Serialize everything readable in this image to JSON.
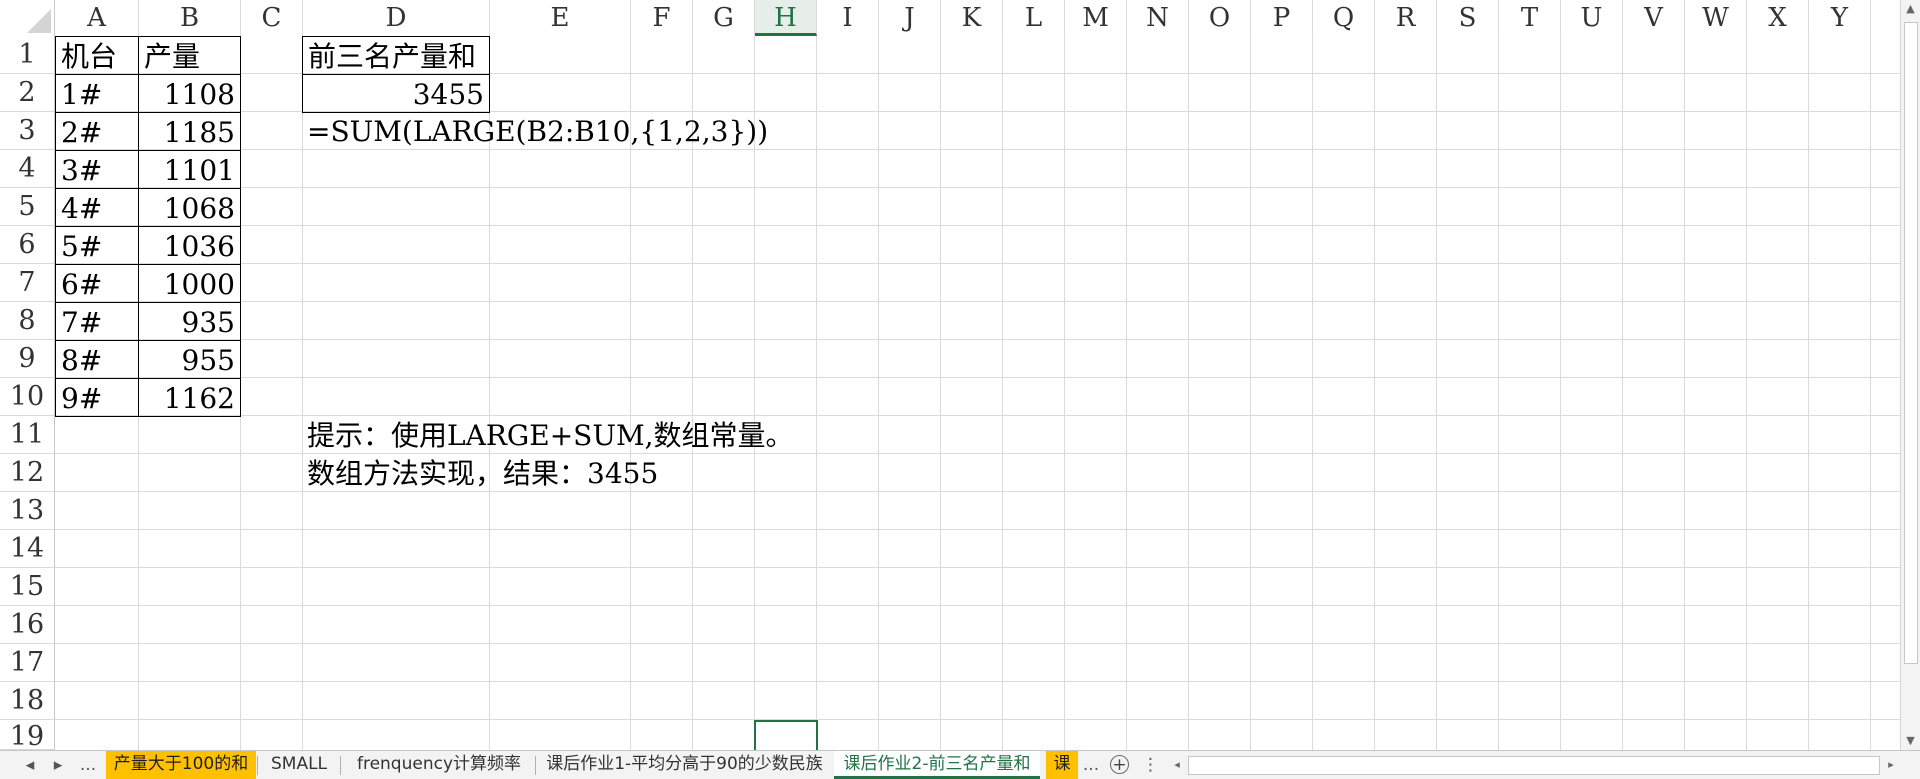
{
  "columns": [
    "A",
    "B",
    "C",
    "D",
    "E",
    "F",
    "G",
    "H",
    "I",
    "J",
    "K",
    "L",
    "M",
    "N",
    "O",
    "P",
    "Q",
    "R",
    "S",
    "T",
    "U",
    "V",
    "W",
    "X",
    "Y"
  ],
  "selected_column": "H",
  "rows": [
    "1",
    "2",
    "3",
    "4",
    "5",
    "6",
    "7",
    "8",
    "9",
    "10",
    "11",
    "12",
    "13",
    "14",
    "15",
    "16",
    "17",
    "18",
    "19"
  ],
  "table": {
    "header_machine": "机台",
    "header_output": "产量",
    "entries": [
      {
        "machine": "1#",
        "output": "1108"
      },
      {
        "machine": "2#",
        "output": "1185"
      },
      {
        "machine": "3#",
        "output": "1101"
      },
      {
        "machine": "4#",
        "output": "1068"
      },
      {
        "machine": "5#",
        "output": "1036"
      },
      {
        "machine": "6#",
        "output": "1000"
      },
      {
        "machine": "7#",
        "output": "935"
      },
      {
        "machine": "8#",
        "output": "955"
      },
      {
        "machine": "9#",
        "output": "1162"
      }
    ]
  },
  "result_block": {
    "title": "前三名产量和",
    "value": "3455",
    "formula": "=SUM(LARGE(B2:B10,{1,2,3}))"
  },
  "notes": {
    "line1": "提示：使用LARGE+SUM,数组常量。",
    "line2": "数组方法实现，结果：3455"
  },
  "sheet_tabs": {
    "nav_prev": "◂",
    "nav_next": "▸",
    "more_left": "...",
    "tabs": [
      {
        "label": "产量大于100的和",
        "style": "orange"
      },
      {
        "label": "SMALL",
        "style": "normal"
      },
      {
        "label": "frenquency计算频率",
        "style": "normal"
      },
      {
        "label": "课后作业1-平均分高于90的少数民族",
        "style": "normal"
      },
      {
        "label": "课后作业2-前三名产量和",
        "style": "active"
      },
      {
        "label": "课",
        "style": "orange"
      }
    ],
    "more_right": "...",
    "add_symbol": "+",
    "splitter": "⋮"
  },
  "colors": {
    "accent": "#217346",
    "tab_orange": "#ffc000",
    "gridline": "#dadada"
  }
}
